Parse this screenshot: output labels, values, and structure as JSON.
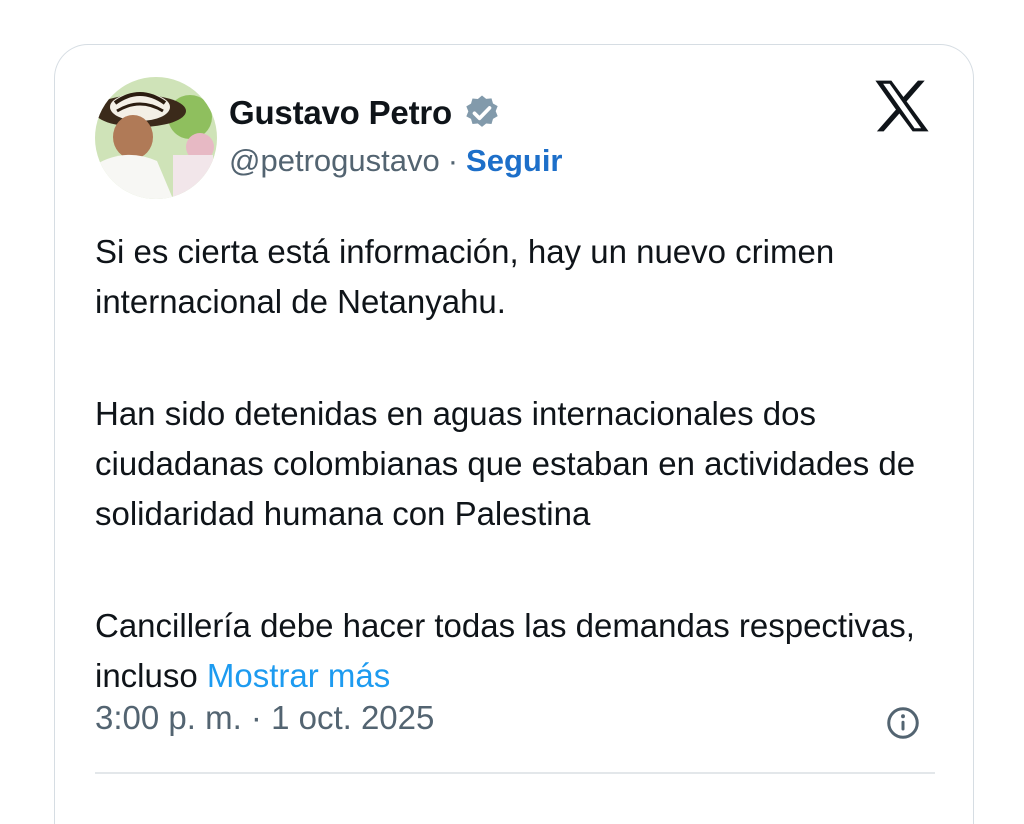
{
  "author": {
    "name": "Gustavo Petro",
    "handle": "@petrogustavo",
    "separator": "·",
    "follow_label": "Seguir",
    "verified_icon": "verified-badge-icon",
    "avatar_icon": "profile-avatar"
  },
  "platform_icon": "x-logo-icon",
  "tweet": {
    "paragraphs": [
      "Si es cierta está información, hay un nuevo crimen internacional de Netanyahu.",
      "Han sido detenidas en aguas internacionales dos ciudadanas colombianas  que estaban en actividades de solidaridad humana con Palestina",
      "Cancillería debe hacer todas las demandas respectivas, incluso"
    ],
    "show_more_label": "Mostrar más"
  },
  "meta": {
    "timestamp": "3:00 p. m. · 1 oct. 2025",
    "info_icon": "info-icon"
  },
  "colors": {
    "link": "#1d9bf0",
    "follow": "#1d6fc9",
    "secondary_text": "#536471",
    "verified": "#829aab"
  }
}
